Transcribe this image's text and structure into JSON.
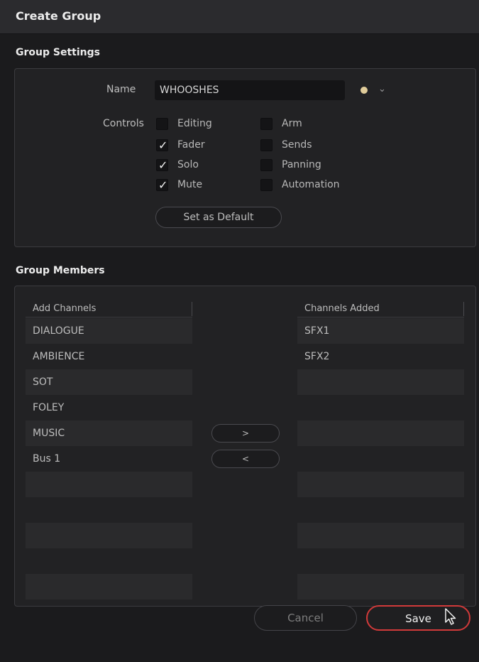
{
  "dialog": {
    "title": "Create Group"
  },
  "settings": {
    "section_title": "Group Settings",
    "name_label": "Name",
    "name_value": "WHOOSHES",
    "color_swatch": "#e0cc9a",
    "controls_label": "Controls",
    "controls": {
      "editing": {
        "label": "Editing",
        "checked": false
      },
      "fader": {
        "label": "Fader",
        "checked": true
      },
      "solo": {
        "label": "Solo",
        "checked": true
      },
      "mute": {
        "label": "Mute",
        "checked": true
      },
      "arm": {
        "label": "Arm",
        "checked": false
      },
      "sends": {
        "label": "Sends",
        "checked": false
      },
      "panning": {
        "label": "Panning",
        "checked": false
      },
      "automation": {
        "label": "Automation",
        "checked": false
      }
    },
    "default_button": "Set as Default"
  },
  "members": {
    "section_title": "Group Members",
    "add_header": "Add Channels",
    "added_header": "Channels Added",
    "add_channels": [
      "DIALOGUE",
      "AMBIENCE",
      "SOT",
      "FOLEY",
      "MUSIC",
      "Bus 1",
      "",
      "",
      "",
      "",
      ""
    ],
    "channels_added": [
      "SFX1",
      "SFX2",
      "",
      "",
      "",
      "",
      "",
      "",
      "",
      "",
      ""
    ],
    "add_button": ">",
    "remove_button": "<"
  },
  "footer": {
    "cancel": "Cancel",
    "save": "Save"
  },
  "colors": {
    "save_border": "#d13a3a",
    "background": "#1b1b1d",
    "panel": "#222224"
  }
}
